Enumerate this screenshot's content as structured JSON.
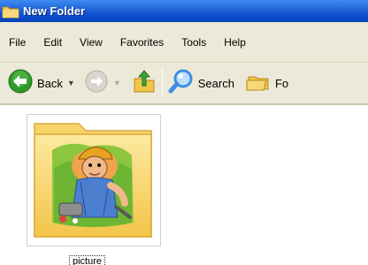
{
  "window": {
    "title": "New Folder",
    "icon": "folder-icon"
  },
  "menu": {
    "items": [
      "File",
      "Edit",
      "View",
      "Favorites",
      "Tools",
      "Help"
    ]
  },
  "toolbar": {
    "back_label": "Back",
    "search_label": "Search",
    "folders_label": "Fo",
    "icons": [
      "back-arrow-icon",
      "forward-arrow-icon",
      "up-folder-icon",
      "search-icon",
      "folders-icon"
    ],
    "colors": {
      "back": "#2f9a2a",
      "search": "#3c8ee6",
      "folder": "#f2c64a"
    }
  },
  "content": {
    "items": [
      {
        "name": "picture",
        "type": "folder",
        "thumbnail": "cartoon-plumber-image"
      }
    ]
  }
}
